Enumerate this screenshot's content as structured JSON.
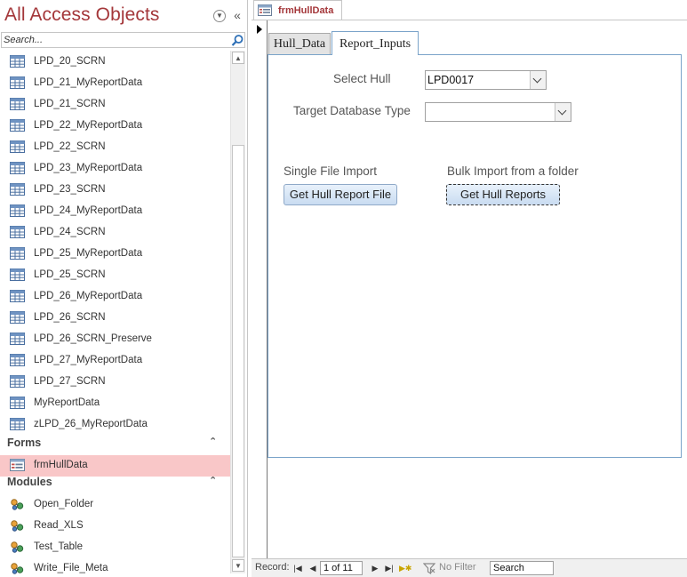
{
  "nav": {
    "title": "All Access Objects",
    "search_placeholder": "Search...",
    "tables": [
      "LPD_20_SCRN",
      "LPD_21_MyReportData",
      "LPD_21_SCRN",
      "LPD_22_MyReportData",
      "LPD_22_SCRN",
      "LPD_23_MyReportData",
      "LPD_23_SCRN",
      "LPD_24_MyReportData",
      "LPD_24_SCRN",
      "LPD_25_MyReportData",
      "LPD_25_SCRN",
      "LPD_26_MyReportData",
      "LPD_26_SCRN",
      "LPD_26_SCRN_Preserve",
      "LPD_27_MyReportData",
      "LPD_27_SCRN",
      "MyReportData",
      "zLPD_26_MyReportData"
    ],
    "forms_group": "Forms",
    "forms": [
      "frmHullData"
    ],
    "modules_group": "Modules",
    "modules": [
      "Open_Folder",
      "Read_XLS",
      "Test_Table",
      "Write_File_Meta"
    ]
  },
  "doc": {
    "tab_label": "frmHullData",
    "tabs": [
      "Hull_Data",
      "Report_Inputs"
    ],
    "active_tab": "Report_Inputs",
    "select_hull_label": "Select Hull",
    "select_hull_value": "LPD0017",
    "target_db_label": "Target Database Type",
    "target_db_value": "",
    "single_import_label": "Single File Import",
    "single_import_button": "Get Hull Report File",
    "bulk_import_label": "Bulk Import from a folder",
    "bulk_import_button": "Get Hull Reports"
  },
  "record_bar": {
    "record_label": "Record:",
    "position": "1 of 11",
    "filter_label": "No Filter",
    "search_value": "Search"
  },
  "colors": {
    "title": "#a4373a",
    "selected_item": "#f9c7c8",
    "tab_border": "#7aa3c9"
  }
}
